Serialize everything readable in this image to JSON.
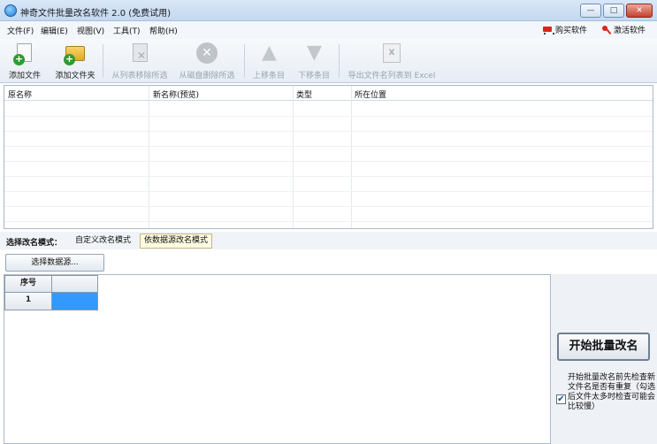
{
  "window": {
    "title": "神奇文件批量改名软件 2.0 (免费试用)",
    "min_symbol": "—",
    "max_symbol": "□",
    "close_symbol": "✕"
  },
  "menu": {
    "items": [
      "文件(F)",
      "编辑(E)",
      "视图(V)",
      "工具(T)",
      "帮助(H)"
    ],
    "buy": "购买软件",
    "activate": "激活软件"
  },
  "toolbar": {
    "add_file": "添加文件",
    "add_folder": "添加文件夹",
    "remove_from_list": "从列表移除所选",
    "delete_from_disk": "从磁盘删除所选",
    "move_up": "上移条目",
    "move_down": "下移条目",
    "export_excel": "导出文件名列表到 Excel",
    "excel_glyph": "X"
  },
  "file_table": {
    "columns": [
      "原名称",
      "新名称(预览)",
      "类型",
      "所在位置"
    ]
  },
  "mode": {
    "label": "选择改名模式：",
    "tabs": [
      "自定义改名模式",
      "依数据源改名模式"
    ],
    "active": "依数据源改名模式"
  },
  "select_source_button": "选择数据源...",
  "grid": {
    "header": [
      "序号",
      ""
    ],
    "rows": [
      [
        "1",
        ""
      ]
    ]
  },
  "start_button": "开始批量改名",
  "check_option": {
    "checked": true,
    "mark": "✔",
    "text": "开始批量改名前先检查新文件名是否有重复（勾选后文件太多时检查可能会比较慢）"
  }
}
